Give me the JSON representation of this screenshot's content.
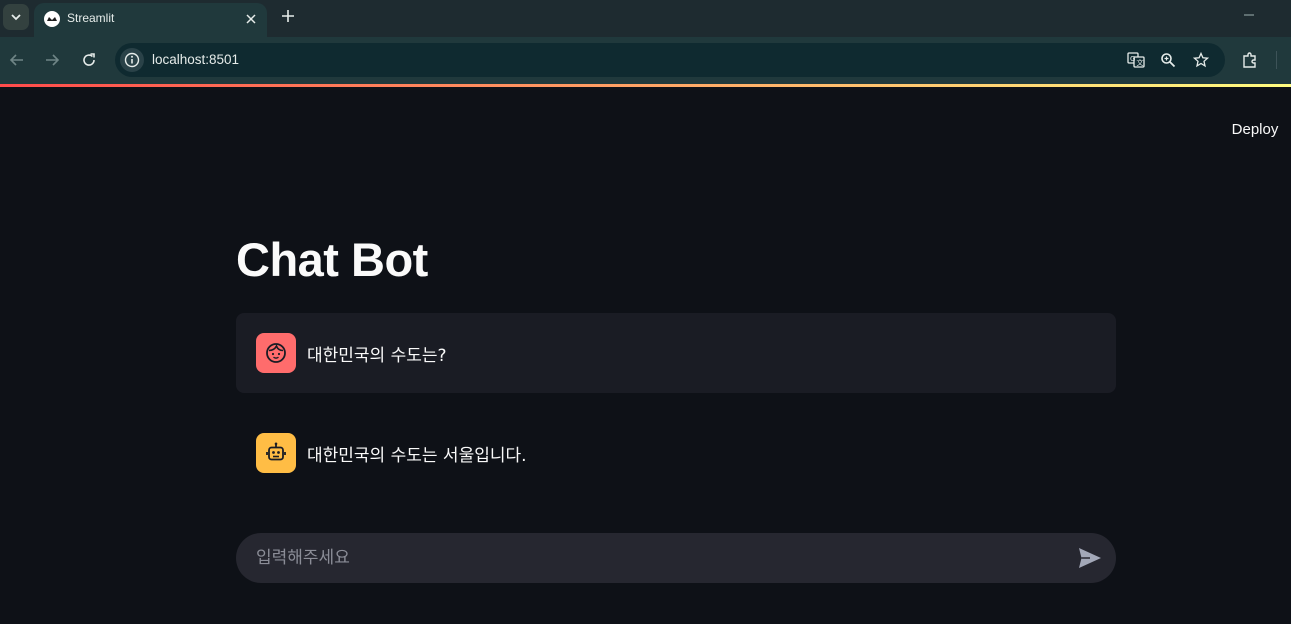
{
  "browser": {
    "tab_title": "Streamlit",
    "url": "localhost:8501"
  },
  "app": {
    "deploy_label": "Deploy",
    "title": "Chat Bot"
  },
  "messages": [
    {
      "role": "user",
      "avatar_icon": "user-face-icon",
      "text": "대한민국의 수도는?"
    },
    {
      "role": "assistant",
      "avatar_icon": "robot-icon",
      "text": "대한민국의 수도는 서울입니다."
    }
  ],
  "chat_input": {
    "placeholder": "입력해주세요",
    "value": ""
  },
  "colors": {
    "background": "#0e1117",
    "user_message_bg": "#1a1c24",
    "user_avatar": "#ff6c6c",
    "assistant_avatar": "#ffbd45",
    "input_bg": "#262730",
    "decoration_start": "#ff4b4b",
    "decoration_end": "#fffd80"
  }
}
